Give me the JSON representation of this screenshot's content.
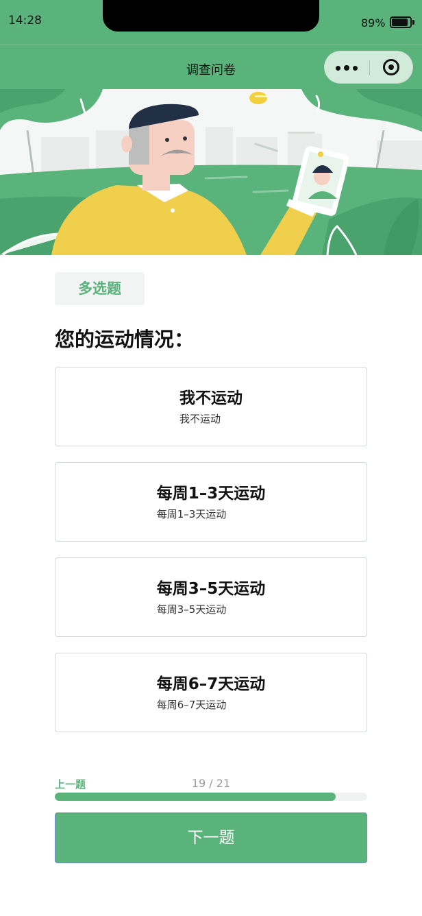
{
  "status_bar": {
    "time": "14:28",
    "battery_percent_text": "89%",
    "battery_level": 0.89
  },
  "nav": {
    "title": "调查问卷"
  },
  "question": {
    "type_tag": "多选题",
    "title": "您的运动情况：",
    "options": [
      {
        "label": "我不运动",
        "sublabel": "我不运动"
      },
      {
        "label": "每周1–3天运动",
        "sublabel": "每周1–3天运动"
      },
      {
        "label": "每周3–5天运动",
        "sublabel": "每周3–5天运动"
      },
      {
        "label": "每周6–7天运动",
        "sublabel": "每周6–7天运动"
      }
    ]
  },
  "footer": {
    "prev_label": "上一题",
    "progress_text": "19 / 21",
    "progress_fraction": 0.9,
    "next_label": "下一题"
  },
  "colors": {
    "brand_green": "#5bb37c",
    "banner_dark_green": "#3f9a63",
    "jacket_yellow": "#f0cf4c"
  },
  "icons": {
    "capsule_more": "more-dots-icon",
    "capsule_close": "target-circle-icon"
  }
}
